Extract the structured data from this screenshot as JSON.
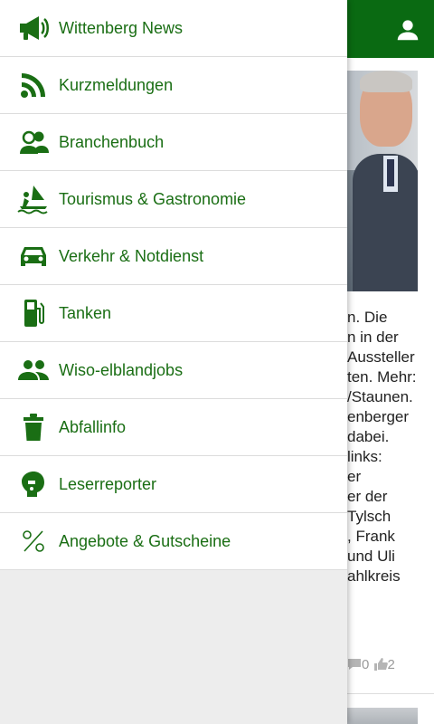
{
  "colors": {
    "brand_green": "#0a6a12",
    "menu_text": "#1a6e14",
    "drawer_bg": "#ededed"
  },
  "header": {
    "user_icon": "user-icon"
  },
  "menu": [
    {
      "label": "Wittenberg News",
      "icon": "megaphone-icon"
    },
    {
      "label": "Kurzmeldungen",
      "icon": "rss-icon"
    },
    {
      "label": "Branchenbuch",
      "icon": "directory-icon"
    },
    {
      "label": "Tourismus & Gastronomie",
      "icon": "windsurf-icon"
    },
    {
      "label": "Verkehr & Notdienst",
      "icon": "car-icon"
    },
    {
      "label": "Tanken",
      "icon": "fuel-pump-icon"
    },
    {
      "label": "Wiso-elblandjobs",
      "icon": "people-icon"
    },
    {
      "label": "Abfallinfo",
      "icon": "trash-icon"
    },
    {
      "label": "Leserreporter",
      "icon": "reporter-icon"
    },
    {
      "label": "Angebote & Gutscheine",
      "icon": "percent-icon"
    }
  ],
  "article": {
    "text_lines": [
      "n. Die",
      "n in der",
      "Aussteller",
      "ten. Mehr:",
      "/Staunen.",
      "enberger",
      "dabei.",
      "links:",
      "er",
      "er der",
      "Tylsch",
      ", Frank",
      "und Uli",
      "ahlkreis"
    ],
    "comments_count": "0",
    "likes_count": "2"
  }
}
